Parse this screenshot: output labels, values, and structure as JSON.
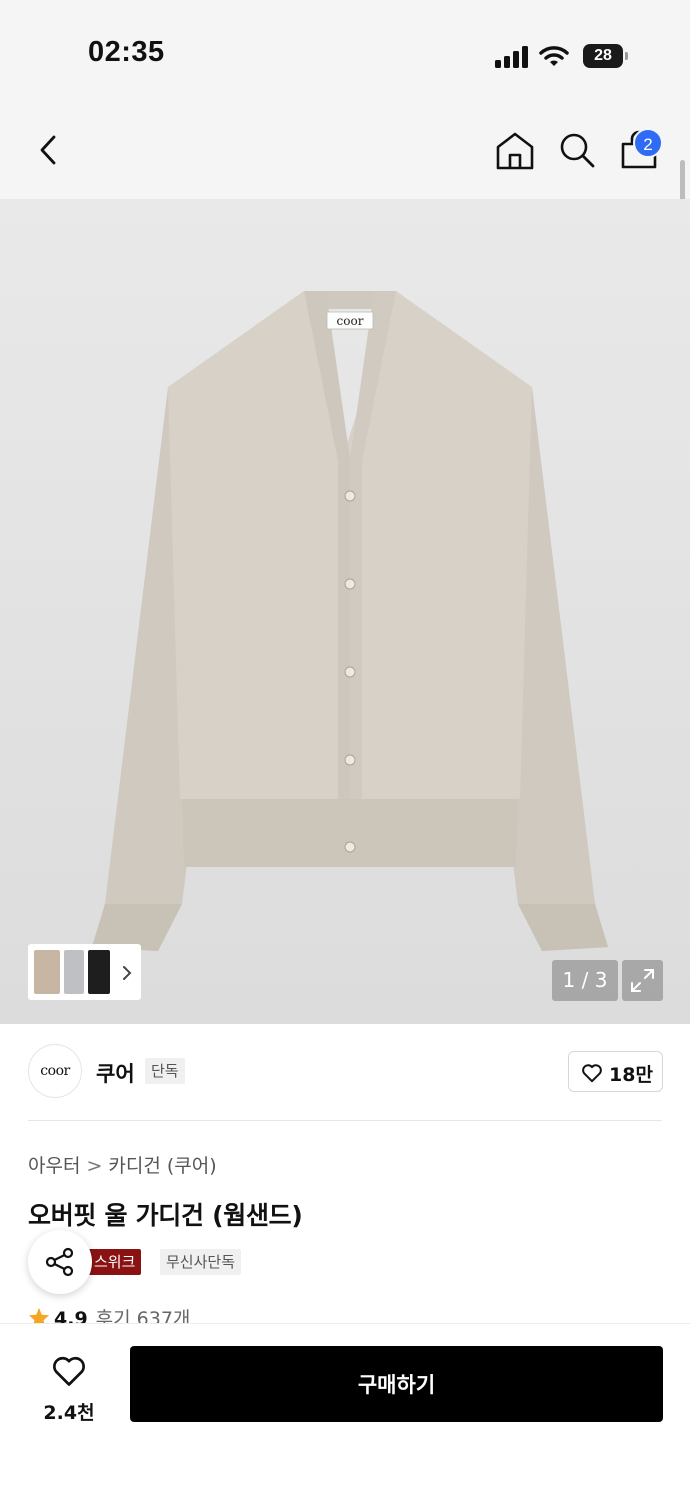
{
  "status_bar": {
    "time": "02:35",
    "battery": "28"
  },
  "nav": {
    "cart_count": "2"
  },
  "gallery": {
    "cardigan_label": "coor",
    "counter": "1 / 3"
  },
  "brand": {
    "logo_text": "coor",
    "name": "쿠어",
    "badge": "단독",
    "like_count": "18만"
  },
  "breadcrumb": {
    "category": "아우터",
    "sep": ">",
    "subcategory": "카디건 (쿠어)"
  },
  "product": {
    "title": "오버핏 울 가디건 (웜샌드)",
    "tags": [
      "스위크",
      "무신사단독"
    ],
    "rating": "4.9",
    "reviews": "후기 637개"
  },
  "bottom": {
    "wish_count": "2.4천",
    "buy_label": "구매하기"
  },
  "colors": {
    "accent_blue": "#2f6bf5",
    "tag_red": "#8b1212",
    "cardigan": "#d5cfc5"
  }
}
